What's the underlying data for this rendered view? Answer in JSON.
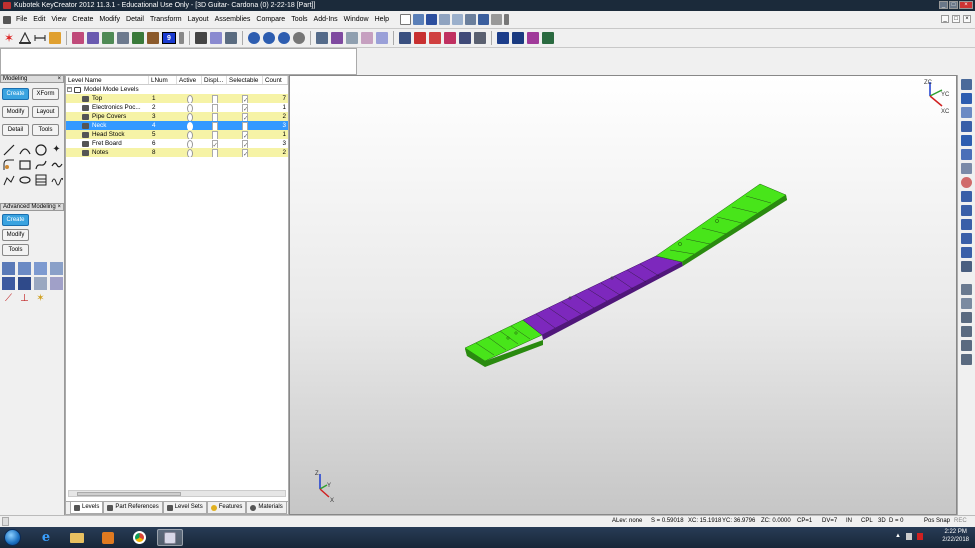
{
  "window": {
    "title": "Kubotek KeyCreator 2012 11.3.1 - Educational Use Only - [3D Guitar- Cardona (0) 2-22-18 [Part]]"
  },
  "menu": [
    "File",
    "Edit",
    "View",
    "Create",
    "Modify",
    "Detail",
    "Transform",
    "Layout",
    "Assemblies",
    "Compare",
    "Tools",
    "Add-Ins",
    "Window",
    "Help"
  ],
  "toolbar": {
    "active_layer": "9"
  },
  "modeling_panel": {
    "title": "Modeling",
    "buttons": [
      "Create",
      "XForm",
      "Modify",
      "Layout",
      "Detail",
      "Tools"
    ]
  },
  "advanced_panel": {
    "title": "Advanced Modeling",
    "buttons": [
      "Create",
      "Modify",
      "Tools"
    ]
  },
  "levels": {
    "columns": [
      "Level Name",
      "LNum",
      "Active",
      "Displ...",
      "Selectable",
      "Count"
    ],
    "root": "Model Mode Levels",
    "rows": [
      {
        "name": "Top",
        "lnum": "1",
        "display": false,
        "selectable": true,
        "count": "7",
        "style": "yellow"
      },
      {
        "name": "Electronics Poc...",
        "lnum": "2",
        "display": false,
        "selectable": true,
        "count": "1",
        "style": "plain"
      },
      {
        "name": "Pipe Covers",
        "lnum": "3",
        "display": false,
        "selectable": true,
        "count": "2",
        "style": "yellow"
      },
      {
        "name": "Neck",
        "lnum": "4",
        "display": false,
        "selectable": false,
        "count": "3",
        "style": "selected"
      },
      {
        "name": "Head Stock",
        "lnum": "5",
        "display": false,
        "selectable": true,
        "count": "1",
        "style": "yellow"
      },
      {
        "name": "Fret Board",
        "lnum": "6",
        "display": true,
        "selectable": true,
        "count": "3",
        "style": "plain"
      },
      {
        "name": "Notes",
        "lnum": "8",
        "display": false,
        "selectable": true,
        "count": "2",
        "style": "yellow"
      }
    ]
  },
  "tabs": [
    "Levels",
    "Part References",
    "Level Sets",
    "Features",
    "Materials"
  ],
  "viewport": {
    "triad_top": [
      "ZC",
      "YC",
      "XC"
    ],
    "triad_bottom": [
      "Z",
      "Y",
      "X"
    ]
  },
  "status": {
    "alev": "ALev: none",
    "scale": "S = 0.59018",
    "xc": "XC: 15.1918",
    "yc": "YC: 36.9796",
    "zc": "ZC: 0.0000",
    "cp": "CP=1",
    "dv": "DV=7",
    "units": "IN",
    "cpl": "CPL",
    "dim": "3D",
    "d": "D = 0",
    "possnap": "Pos Snap",
    "rec": "REC"
  },
  "clock": {
    "time": "2:22 PM",
    "date": "2/22/2018"
  }
}
